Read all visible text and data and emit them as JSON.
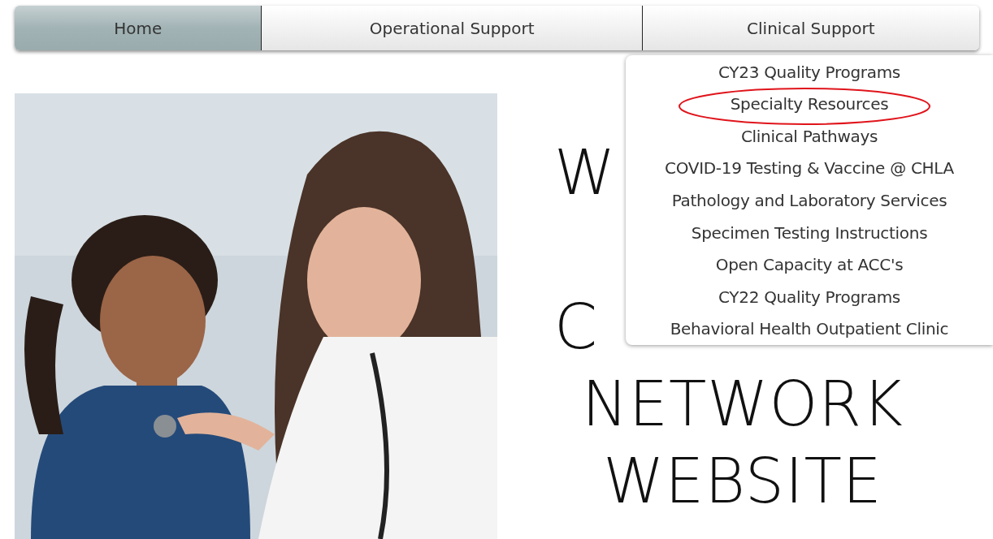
{
  "nav": {
    "tabs": [
      {
        "label": "Home",
        "selected": true
      },
      {
        "label": "Operational Support",
        "selected": false
      },
      {
        "label": "Clinical Support",
        "selected": false
      }
    ]
  },
  "dropdown": {
    "items": [
      {
        "label": "CY23 Quality Programs",
        "circled": false
      },
      {
        "label": "Specialty Resources",
        "circled": true
      },
      {
        "label": "Clinical Pathways",
        "circled": false
      },
      {
        "label": "COVID-19 Testing & Vaccine @ CHLA",
        "circled": false
      },
      {
        "label": "Pathology and Laboratory Services",
        "circled": false
      },
      {
        "label": "Specimen Testing Instructions",
        "circled": false
      },
      {
        "label": "Open Capacity at ACC's",
        "circled": false
      },
      {
        "label": "CY22 Quality Programs",
        "circled": false
      },
      {
        "label": "Behavioral Health Outpatient Clinic",
        "circled": false
      }
    ]
  },
  "hero": {
    "heading_lines": [
      {
        "text": "W",
        "kind": "partial"
      },
      {
        "text": "C",
        "kind": "partial"
      },
      {
        "text": "NETWORK",
        "kind": "full"
      },
      {
        "text": "WEBSITE",
        "kind": "full"
      }
    ]
  }
}
